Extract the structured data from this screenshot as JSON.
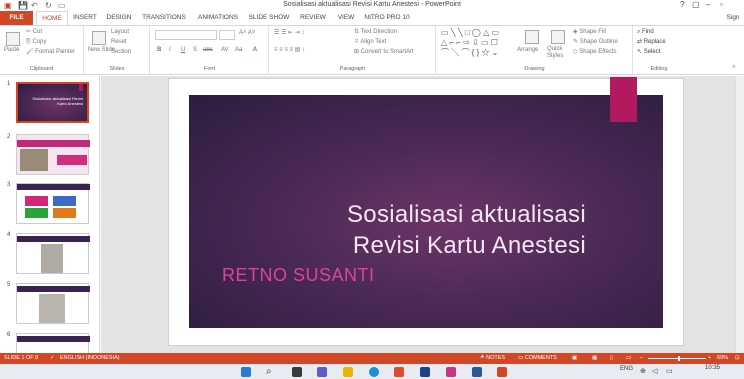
{
  "window": {
    "title": "Sosialisasi aktualisasi Revisi Kartu Anestesi - PowerPoint",
    "help": "?",
    "user": "Sign"
  },
  "tabs": [
    "FILE",
    "HOME",
    "INSERT",
    "DESIGN",
    "TRANSITIONS",
    "ANIMATIONS",
    "SLIDE SHOW",
    "REVIEW",
    "VIEW",
    "NITRO PRO 10"
  ],
  "ribbon": {
    "clipboard": {
      "label": "Clipboard",
      "paste": "Paste",
      "cut": "Cut",
      "copy": "Copy",
      "format_painter": "Format Painter"
    },
    "slides": {
      "label": "Slides",
      "new_slide": "New Slide",
      "layout": "Layout",
      "reset": "Reset",
      "section": "Section"
    },
    "font": {
      "label": "Font",
      "bold": "B",
      "italic": "I",
      "underline": "U",
      "shadow": "S",
      "strike": "abc"
    },
    "paragraph": {
      "label": "Paragraph",
      "text_direction": "Text Direction",
      "align_text": "Align Text",
      "convert": "Convert to SmartArt"
    },
    "drawing": {
      "label": "Drawing",
      "arrange": "Arrange",
      "quick_styles": "Quick Styles",
      "shape_fill": "Shape Fill",
      "shape_outline": "Shape Outline",
      "shape_effects": "Shape Effects"
    },
    "editing": {
      "label": "Editing",
      "find": "Find",
      "replace": "Replace",
      "select": "Select"
    }
  },
  "thumbnails": [
    {
      "num": "1",
      "text": "Sosialisasi aktualisasi Revisi Kartu Anestesi"
    },
    {
      "num": "2",
      "text": ""
    },
    {
      "num": "3",
      "text": ""
    },
    {
      "num": "4",
      "text": ""
    },
    {
      "num": "5",
      "text": ""
    },
    {
      "num": "6",
      "text": ""
    }
  ],
  "slide": {
    "title_line1": "Sosialisasi aktualisasi",
    "title_line2": "Revisi Kartu Anestesi",
    "subtitle": "RETNO SUSANTI"
  },
  "statusbar": {
    "slide": "SLIDE 1 OF 8",
    "language": "ENGLISH (INDONESIA)",
    "notes": "NOTES",
    "comments": "COMMENTS",
    "zoom": "69%"
  },
  "taskbar": {
    "lang": "ENG",
    "time": "10:35"
  },
  "colors": {
    "accent": "#d24726",
    "slide_accent": "#b3195f",
    "subtitle": "#e0429a"
  }
}
